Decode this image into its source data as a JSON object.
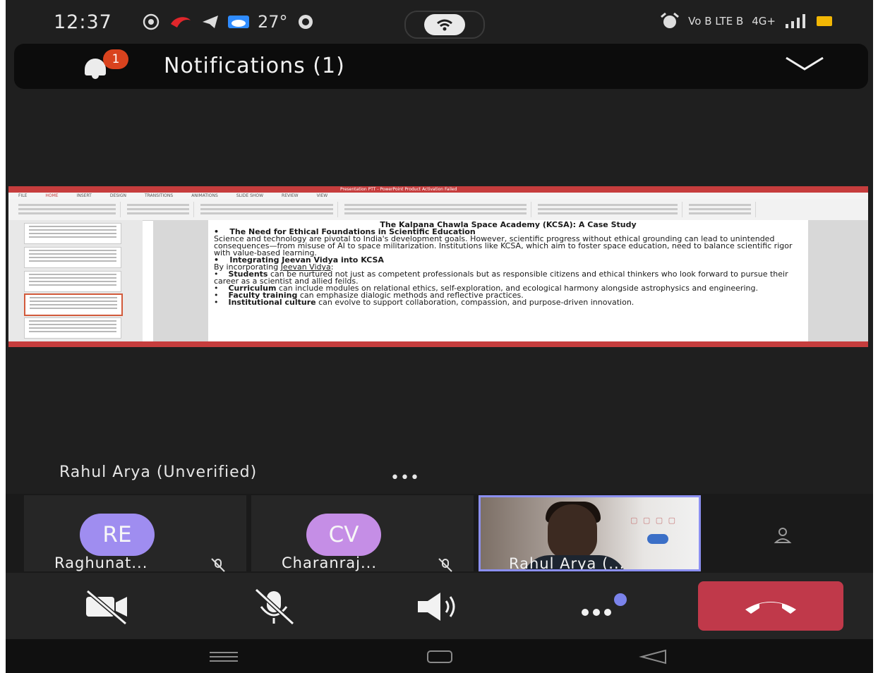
{
  "status_bar": {
    "time": "12:37",
    "temperature": "27°",
    "network_label": "Vo B LTE B",
    "signal_label": "4G+",
    "battery_color": "#f2b705"
  },
  "notification_bar": {
    "title": "Notifications (1)",
    "badge_count": "1",
    "badge_color": "#d9431e"
  },
  "shared_screen": {
    "window_title": "Presentation PTT - PowerPoint Product Activation Failed",
    "ribbon_tabs": [
      "FILE",
      "HOME",
      "INSERT",
      "DESIGN",
      "TRANSITIONS",
      "ANIMATIONS",
      "SLIDE SHOW",
      "REVIEW",
      "VIEW"
    ],
    "selected_tab": "HOME",
    "slide": {
      "title": "The Kalpana Chawla Space Academy (KCSA): A Case Study",
      "heading1": "The Need for Ethical Foundations in Scientific Education",
      "para1": "Science and technology are pivotal to India's development goals. However, scientific progress without ethical grounding can lead to unintended consequences—from misuse of AI to space militarization. Institutions like KCSA, which aim to foster space education, need to balance scientific rigor with value-based learning.",
      "heading2": "Integrating Jeevan Vidya into KCSA",
      "intro_prefix": "By incorporating ",
      "intro_link": "Jeevan Vidya",
      "intro_suffix": ":",
      "bullets": [
        {
          "bold": "Students",
          "text": " can be nurtured not just as competent professionals but as responsible citizens and ethical thinkers who look forward to pursue their career as a scientist and allied feilds."
        },
        {
          "bold": "Curriculum",
          "text": " can include modules on relational ethics, self-exploration, and ecological harmony alongside astrophysics and engineering."
        },
        {
          "bold": "Faculty training",
          "text": " can emphasize dialogic methods and reflective practices."
        },
        {
          "bold": "Institutional culture",
          "text": " can evolve to support collaboration, compassion, and purpose-driven innovation."
        }
      ]
    },
    "accent_color": "#c63d3d"
  },
  "presenter": {
    "label": "Rahul Arya (Unverified)",
    "more_label": "•••"
  },
  "participants": [
    {
      "initials": "RE",
      "name": "Raghunat...",
      "avatar_color": "#9f8df0"
    },
    {
      "initials": "CV",
      "name": "Charanraj...",
      "avatar_color": "#c58ee6"
    },
    {
      "name": "Rahul Arya (...",
      "has_video": true,
      "highlight_color": "#8b8ff0"
    }
  ],
  "controls": {
    "leave_color": "#c0394a",
    "more_dot_color": "#7b83eb"
  }
}
